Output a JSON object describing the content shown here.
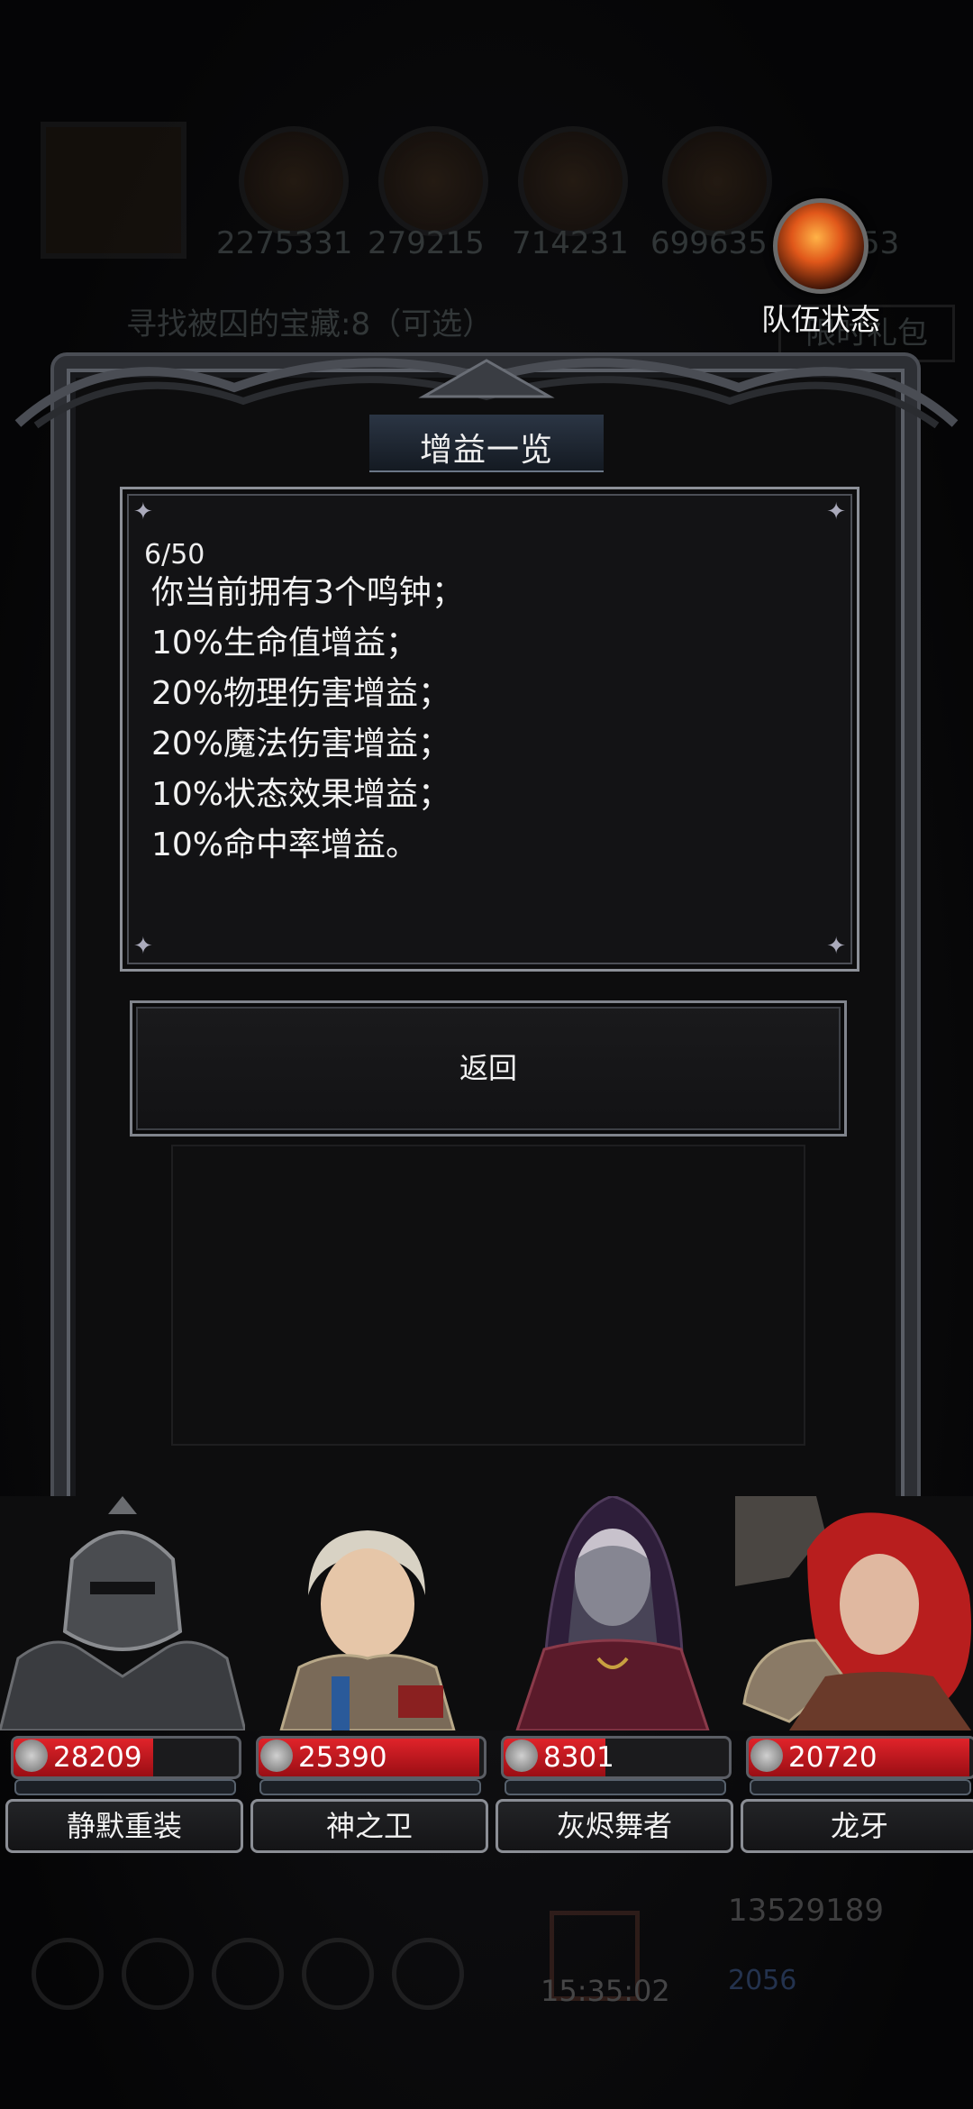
{
  "hud": {
    "resources": [
      "2275331",
      "279215",
      "714231",
      "699635",
      "53"
    ],
    "quest_text": "寻找被囚的宝藏:8（可选）",
    "limited_pack": "限时礼包"
  },
  "team_status": {
    "label": "队伍状态"
  },
  "panel": {
    "title": "增益一览",
    "page_counter": "6/50",
    "lines": [
      "你当前拥有3个鸣钟；",
      "10%生命值增益；",
      "20%物理伤害增益；",
      "20%魔法伤害增益；",
      "10%状态效果增益；",
      "10%命中率增益。"
    ],
    "return_label": "返回"
  },
  "characters": [
    {
      "name": "静默重装",
      "hp": "28209",
      "hp_fraction": 0.62
    },
    {
      "name": "神之卫",
      "hp": "25390",
      "hp_fraction": 0.98
    },
    {
      "name": "灰烬舞者",
      "hp": "8301",
      "hp_fraction": 0.45
    },
    {
      "name": "龙牙",
      "hp": "20720",
      "hp_fraction": 0.98
    }
  ],
  "bottom_hud": {
    "time": "15:35:02",
    "gold": "13529189",
    "gems": "2056"
  },
  "colors": {
    "hp_red": "#d11a22",
    "frame_silver": "#8c9098",
    "panel_bg": "#131315"
  }
}
